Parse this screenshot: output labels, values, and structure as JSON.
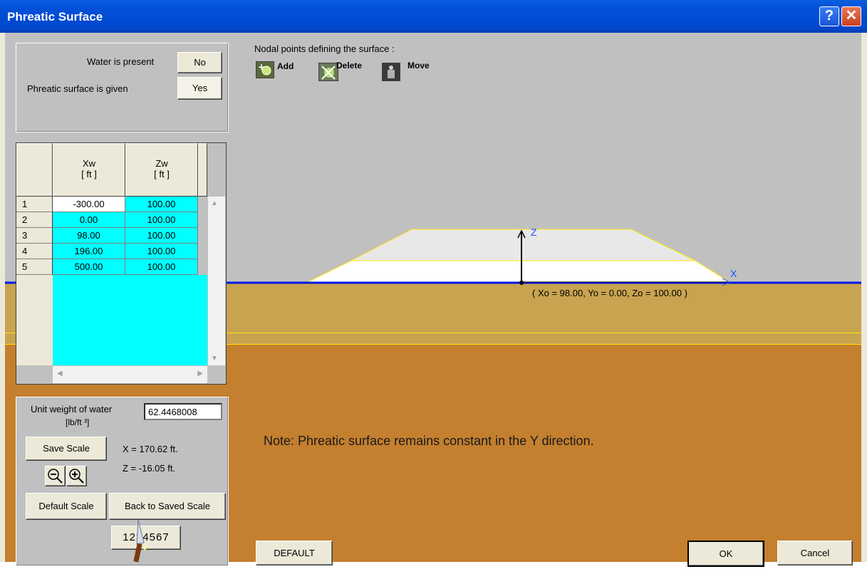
{
  "window": {
    "title": "Phreatic Surface",
    "help_glyph": "?",
    "close_glyph": "✕"
  },
  "water": {
    "present_label": "Water is present",
    "present_value": "No",
    "given_label": "Phreatic surface is given",
    "given_value": "Yes"
  },
  "table": {
    "col1": "Xw",
    "col1_unit": "[ ft ]",
    "col2": "Zw",
    "col2_unit": "[ ft ]",
    "rows": [
      {
        "n": "1",
        "x": "-300.00",
        "z": "100.00"
      },
      {
        "n": "2",
        "x": "0.00",
        "z": "100.00"
      },
      {
        "n": "3",
        "x": "98.00",
        "z": "100.00"
      },
      {
        "n": "4",
        "x": "196.00",
        "z": "100.00"
      },
      {
        "n": "5",
        "x": "500.00",
        "z": "100.00"
      }
    ]
  },
  "unit_weight": {
    "label": "Unit weight of water",
    "unit": "[lb/ft ³]",
    "value": "62.4468008"
  },
  "scale": {
    "save": "Save Scale",
    "default": "Default Scale",
    "back": "Back to Saved Scale",
    "x_readout": "X = 170.62 ft.",
    "z_readout": "Z = -16.05 ft.",
    "counter": "1234567"
  },
  "toolbar": {
    "heading": "Nodal points defining the surface :",
    "add": "Add",
    "delete": "Delete",
    "move": "Move"
  },
  "canvas": {
    "z_axis": "Z",
    "x_axis": "X",
    "origin": "( Xo = 98.00, Yo = 0.00,  Zo = 100.00 )",
    "note": "Note: Phreatic surface remains constant in the Y direction."
  },
  "buttons": {
    "default": "DEFAULT",
    "ok": "OK",
    "cancel": "Cancel"
  },
  "colors": {
    "sky": "#c0c0c0",
    "water_line": "#0018e8",
    "ground_upper": "#c8a350",
    "ground_lower": "#c47f2f",
    "table_cells": "#00ffff"
  }
}
